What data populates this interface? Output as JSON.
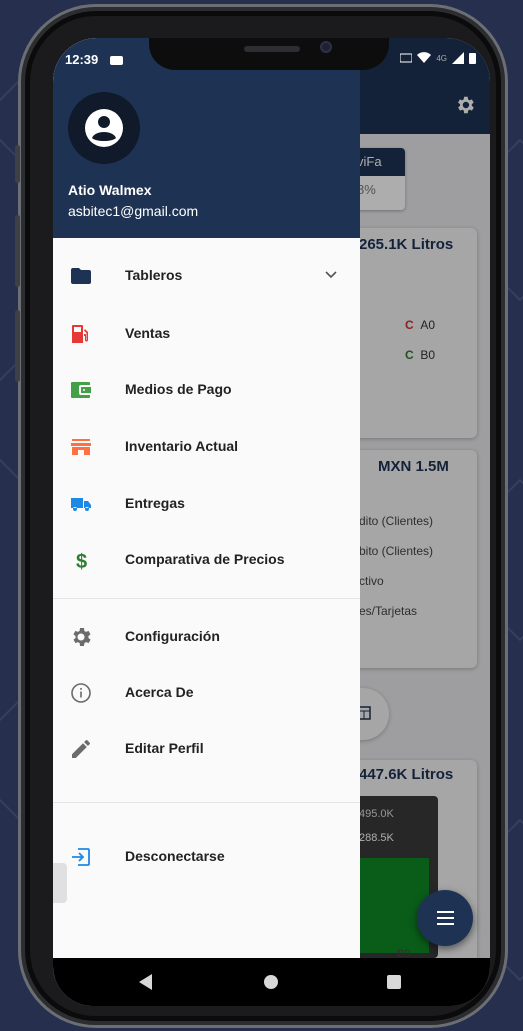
{
  "status_bar": {
    "time": "12:39",
    "network": "4G"
  },
  "drawer": {
    "user": {
      "name": "Atio Walmex",
      "email": "asbitec1@gmail.com"
    },
    "items": [
      {
        "label": "Tableros",
        "icon": "folder-icon",
        "color": "#1e3354"
      },
      {
        "label": "Ventas",
        "icon": "gas-station-icon",
        "color": "#e53935"
      },
      {
        "label": "Medios de Pago",
        "icon": "wallet-icon",
        "color": "#43a047"
      },
      {
        "label": "Inventario Actual",
        "icon": "store-icon",
        "color": "#ff7043"
      },
      {
        "label": "Entregas",
        "icon": "truck-icon",
        "color": "#1e88e5"
      },
      {
        "label": "Comparativa de Precios",
        "icon": "dollar-icon",
        "color": "#2e7d32"
      }
    ],
    "settings_items": [
      {
        "label": "Configuración",
        "icon": "gear-icon"
      },
      {
        "label": "Acerca De",
        "icon": "info-icon"
      },
      {
        "label": "Editar Perfil",
        "icon": "pencil-icon"
      }
    ],
    "logout": {
      "label": "Desconectarse",
      "icon": "logout-icon",
      "color": "#1e88e5"
    }
  },
  "background_app": {
    "chip_top": "viFa",
    "chip_bottom": "8%",
    "card1_title": "265.1K Litros",
    "card1_legend": [
      "A0",
      "B0"
    ],
    "card2_title": "MXN 1.5M",
    "card2_lines": [
      "dito (Clientes)",
      "bito (Clientes)",
      "ctivo",
      "es/Tarjetas"
    ],
    "card3_title": "447.6K Litros",
    "chart_labels": [
      "495.0K",
      "288.5K"
    ],
    "axis_label": "B0"
  },
  "colors": {
    "primary": "#1e3354",
    "background": "#26304e"
  }
}
